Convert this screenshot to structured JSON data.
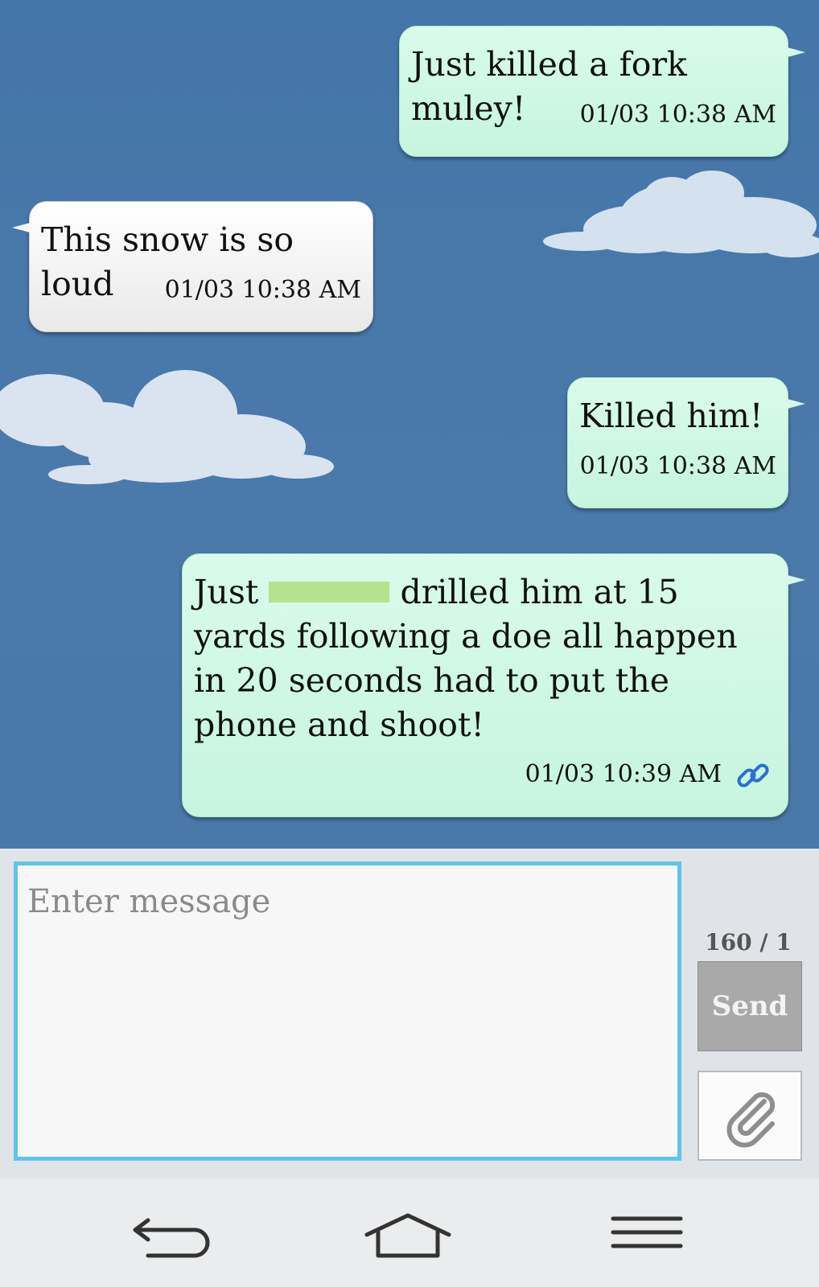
{
  "messages": [
    {
      "direction": "outgoing",
      "text": "Just killed a fork muley!",
      "time": "01/03 10:38 AM"
    },
    {
      "direction": "incoming",
      "text": "This snow is so loud",
      "time": "01/03 10:38 AM"
    },
    {
      "direction": "outgoing",
      "text": "Killed him!",
      "time": "01/03 10:38 AM"
    },
    {
      "direction": "outgoing",
      "text_before": "Just",
      "text_after": "drilled him at 15 yards following a doe all happen in 20 seconds had to put the phone and shoot!",
      "time": "01/03 10:39 AM",
      "icon": "link-icon"
    }
  ],
  "composer": {
    "placeholder": "Enter message",
    "counter": "160 / 1",
    "send_label": "Send",
    "attach_icon": "paperclip-icon"
  },
  "navbar": {
    "back_icon": "back-icon",
    "home_icon": "home-icon",
    "menu_icon": "menu-icon"
  },
  "colors": {
    "background": "#4a77a8",
    "outgoing_bubble": "#c6f5df",
    "incoming_bubble": "#f2f2f2",
    "input_border": "#5dc6e6",
    "send_button": "#a9a9a9",
    "redaction": "#b5e28f"
  }
}
